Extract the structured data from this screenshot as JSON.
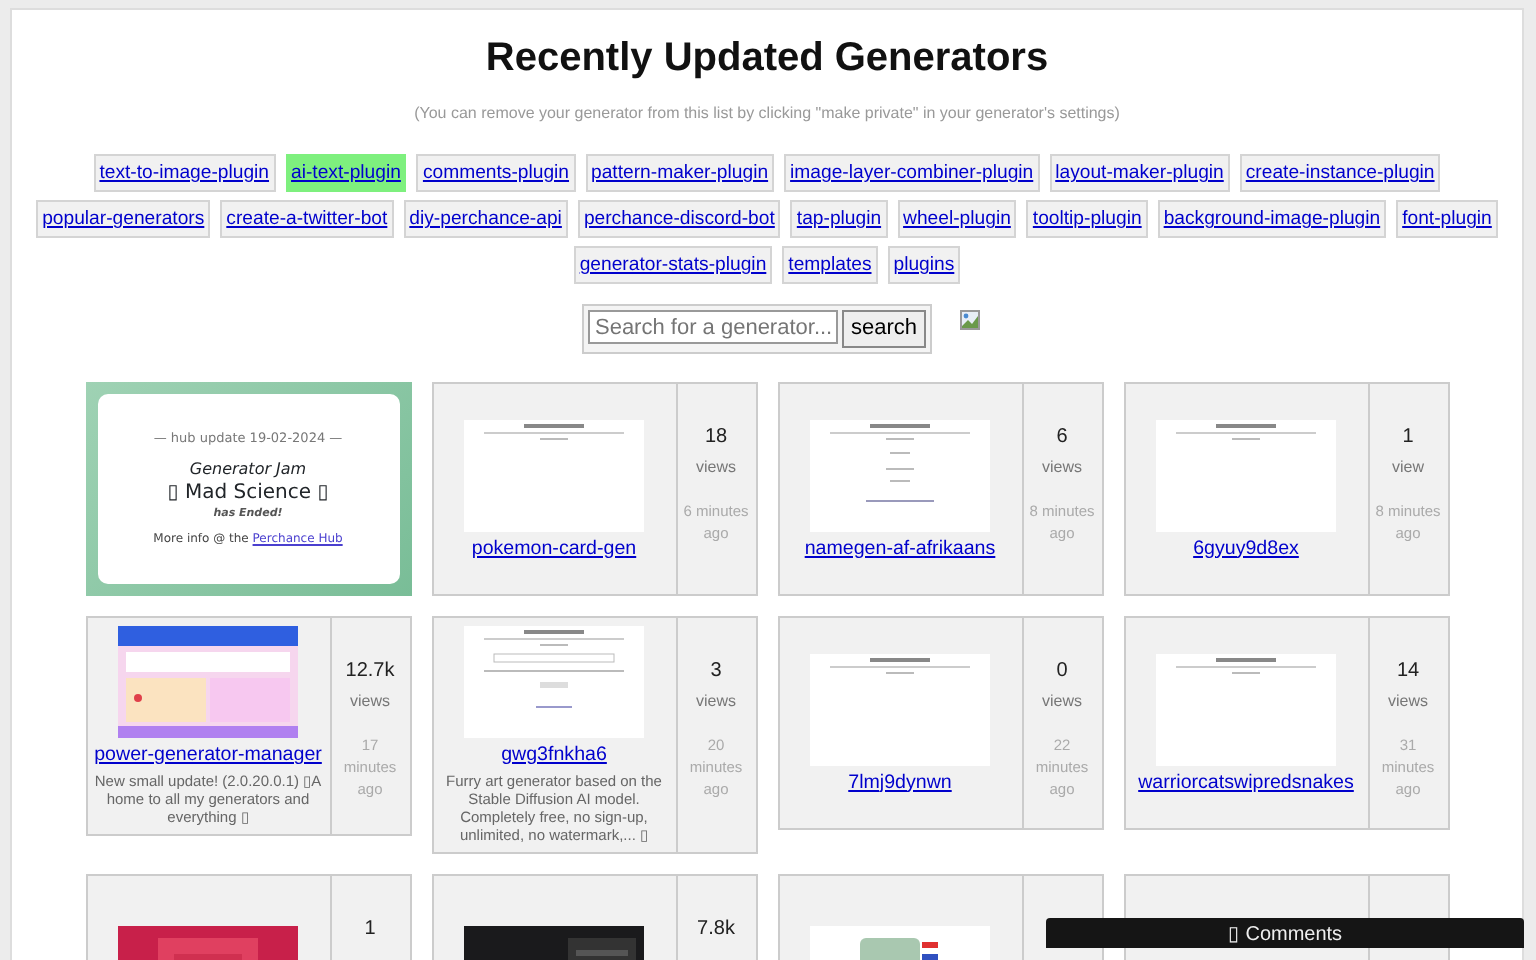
{
  "title": "Recently Updated Generators",
  "note": "(You can remove your generator from this list by clicking \"make private\" in your generator's settings)",
  "tags": [
    {
      "label": "text-to-image-plugin",
      "selected": false
    },
    {
      "label": "ai-text-plugin",
      "selected": true
    },
    {
      "label": "comments-plugin",
      "selected": false
    },
    {
      "label": "pattern-maker-plugin",
      "selected": false
    },
    {
      "label": "image-layer-combiner-plugin",
      "selected": false
    },
    {
      "label": "layout-maker-plugin",
      "selected": false
    },
    {
      "label": "create-instance-plugin",
      "selected": false
    },
    {
      "label": "popular-generators",
      "selected": false
    },
    {
      "label": "create-a-twitter-bot",
      "selected": false
    },
    {
      "label": "diy-perchance-api",
      "selected": false
    },
    {
      "label": "perchance-discord-bot",
      "selected": false
    },
    {
      "label": "tap-plugin",
      "selected": false
    },
    {
      "label": "wheel-plugin",
      "selected": false
    },
    {
      "label": "tooltip-plugin",
      "selected": false
    },
    {
      "label": "background-image-plugin",
      "selected": false
    },
    {
      "label": "font-plugin",
      "selected": false
    },
    {
      "label": "generator-stats-plugin",
      "selected": false
    },
    {
      "label": "templates",
      "selected": false
    },
    {
      "label": "plugins",
      "selected": false
    }
  ],
  "search": {
    "placeholder": "Search for a generator...",
    "button": "search"
  },
  "banner": {
    "kicker": "— hub update 19-02-2024 —",
    "line1": "Generator Jam",
    "line2": "▯ Mad Science ▯",
    "line3": "has Ended!",
    "more_prefix": "More info @ the",
    "more_link": "Perchance Hub"
  },
  "generators": [
    {
      "name": "pokemon-card-gen",
      "views": "18",
      "views_label": "views",
      "time": "6 minutes ago"
    },
    {
      "name": "namegen-af-afrikaans",
      "views": "6",
      "views_label": "views",
      "time": "8 minutes ago"
    },
    {
      "name": "6gyuy9d8ex",
      "views": "1",
      "views_label": "view",
      "time": "8 minutes ago"
    },
    {
      "name": "power-generator-manager",
      "views": "12.7k",
      "views_label": "views",
      "time": "17 minutes ago",
      "description": "New small update! (2.0.20.0.1) ▯A home to all my generators and everything ▯"
    },
    {
      "name": "gwg3fnkha6",
      "views": "3",
      "views_label": "views",
      "time": "20 minutes ago",
      "description": "Furry art generator based on the Stable Diffusion AI model. Completely free, no sign-up, unlimited, no watermark,... ▯"
    },
    {
      "name": "7lmj9dynwn",
      "views": "0",
      "views_label": "views",
      "time": "22 minutes ago"
    },
    {
      "name": "warriorcatswipredsnakes",
      "views": "14",
      "views_label": "views",
      "time": "31 minutes ago"
    },
    {
      "views": "1"
    },
    {
      "views": "7.8k"
    },
    {
      "kind": "picture"
    },
    {
      "kind": "empty"
    }
  ],
  "comments": "▯ Comments"
}
